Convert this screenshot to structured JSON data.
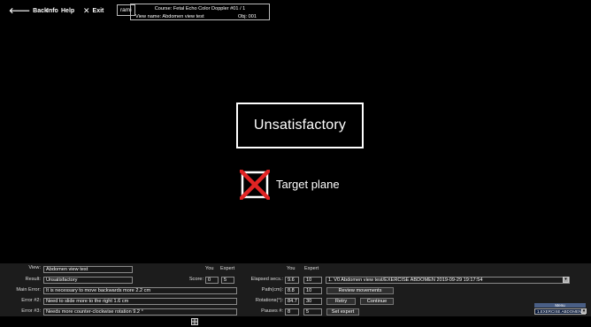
{
  "toolbar": {
    "back_label": "Back",
    "info_label": "Info",
    "help_label": "Help",
    "exit_label": "Exit",
    "user_label": "rami"
  },
  "course": {
    "course_line": "Course: Fetal Echo Color Doppler #01 / 1",
    "view_line": "View name: Abdomen view test",
    "obj_label": "Obj: 001"
  },
  "stage": {
    "result_text": "Unsatisfactory",
    "target_label": "Target plane",
    "target_status": "failed",
    "status_color": "#e02424"
  },
  "panel": {
    "view_label": "View:",
    "view_value": "Abdomen view test",
    "result_label": "Result:",
    "result_value": "Unsatisfactory",
    "main_error_label": "Main Error:",
    "main_error_value": "It is necessary to move backwards more 2.2 cm",
    "error2_label": "Error #2:",
    "error2_value": "Need to slide more to the right 1.6 cm",
    "error3_label": "Error #3:",
    "error3_value": "Needs more counter-clockwise rotation 9.2 °",
    "you_header": "You",
    "expert_header": "Expert",
    "score_label": "Score:",
    "score_you": "0",
    "score_expert": "5",
    "metrics": [
      {
        "label": "Elapsed secs.:",
        "you": "9.6",
        "expert": "10"
      },
      {
        "label": "Path(cm):",
        "you": "8.8",
        "expert": "10"
      },
      {
        "label": "Rotations(°):",
        "you": "84.7",
        "expert": "30"
      },
      {
        "label": "Pauses #:",
        "you": "8",
        "expert": "5"
      }
    ],
    "exercise_select": "1. V0 Abdomen view test/EXERCISE ABDOMEN 2019-09-29 19:17:54",
    "review_button": "Review movements",
    "retry_button": "Retry",
    "continue_button": "Continue",
    "set_expert_button": "Set expert",
    "menu_header": "Menu",
    "menu_value": "1.EXERCISE ABDOMEN"
  }
}
